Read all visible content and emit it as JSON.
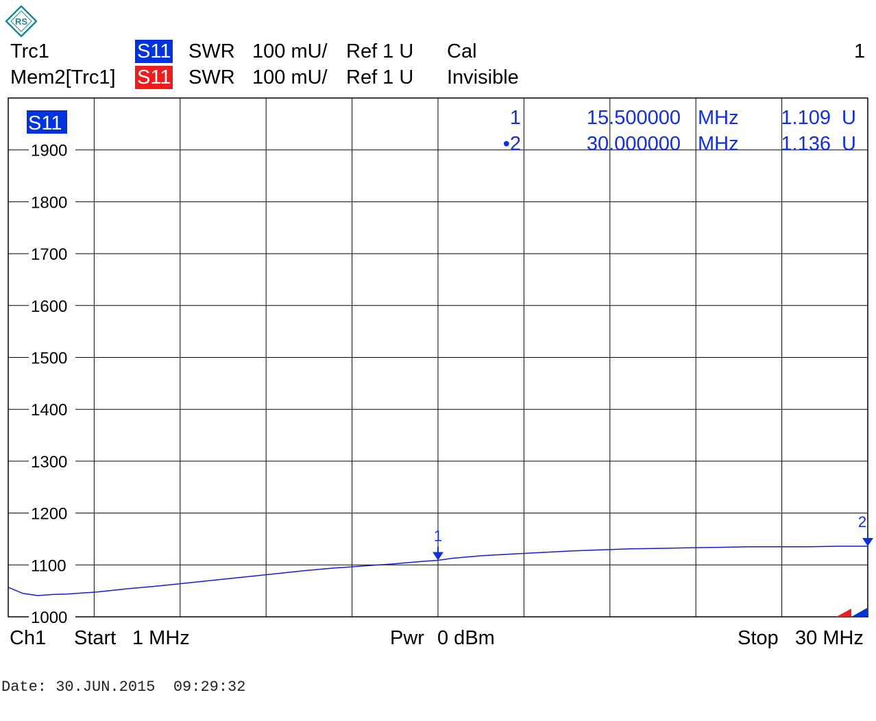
{
  "header": {
    "trc1": {
      "name": "Trc1",
      "param": "S11",
      "format": "SWR",
      "scale": "100 mU/",
      "ref": "Ref 1 U",
      "state": "Cal"
    },
    "mem2": {
      "name": "Mem2[Trc1]",
      "param": "S11",
      "format": "SWR",
      "scale": "100 mU/",
      "ref": "Ref 1 U",
      "state": "Invisible"
    },
    "window_number": "1"
  },
  "footer": {
    "channel": "Ch1",
    "start_label": "Start",
    "start_value": "1 MHz",
    "power_label": "Pwr",
    "power_value": "0 dBm",
    "stop_label": "Stop",
    "stop_value": "30 MHz"
  },
  "date_line": "Date: 30.JUN.2015  09:29:32",
  "colors": {
    "trace": "#1a1acc",
    "tag_blue": "#0033dd",
    "tag_red": "#ee1c1c",
    "marker_text": "#1030e0"
  },
  "chart_data": {
    "type": "line",
    "trace_label": "S11",
    "x_range": [
      1,
      30
    ],
    "ylim": [
      1000,
      2000
    ],
    "y_ticks": [
      1000,
      1100,
      1200,
      1300,
      1400,
      1500,
      1600,
      1700,
      1800,
      1900
    ],
    "grid": true,
    "series": [
      {
        "x": [
          1,
          1.5,
          2,
          2.5,
          3,
          4,
          5,
          6,
          7,
          8,
          9,
          10,
          11,
          12,
          13,
          14,
          15,
          15.5,
          16,
          17,
          18,
          19,
          20,
          21,
          22,
          23,
          24,
          25,
          26,
          27,
          28,
          29,
          30
        ],
        "values": [
          1057,
          1045,
          1041,
          1043,
          1044,
          1048,
          1054,
          1059,
          1065,
          1071,
          1077,
          1083,
          1089,
          1094,
          1098,
          1102,
          1107,
          1109,
          1113,
          1118,
          1121,
          1124,
          1127,
          1129,
          1131,
          1132,
          1133,
          1134,
          1135,
          1135,
          1135,
          1136,
          1136
        ]
      }
    ],
    "markers": [
      {
        "id": "1",
        "x": 15.5,
        "y": 1109,
        "freq": "15.500000",
        "unit": "MHz",
        "value": "1.109",
        "value_unit": "U",
        "active": false
      },
      {
        "id": "2",
        "x": 30,
        "y": 1136,
        "freq": "30.000000",
        "unit": "MHz",
        "value": "1.136",
        "value_unit": "U",
        "active": true
      }
    ]
  }
}
